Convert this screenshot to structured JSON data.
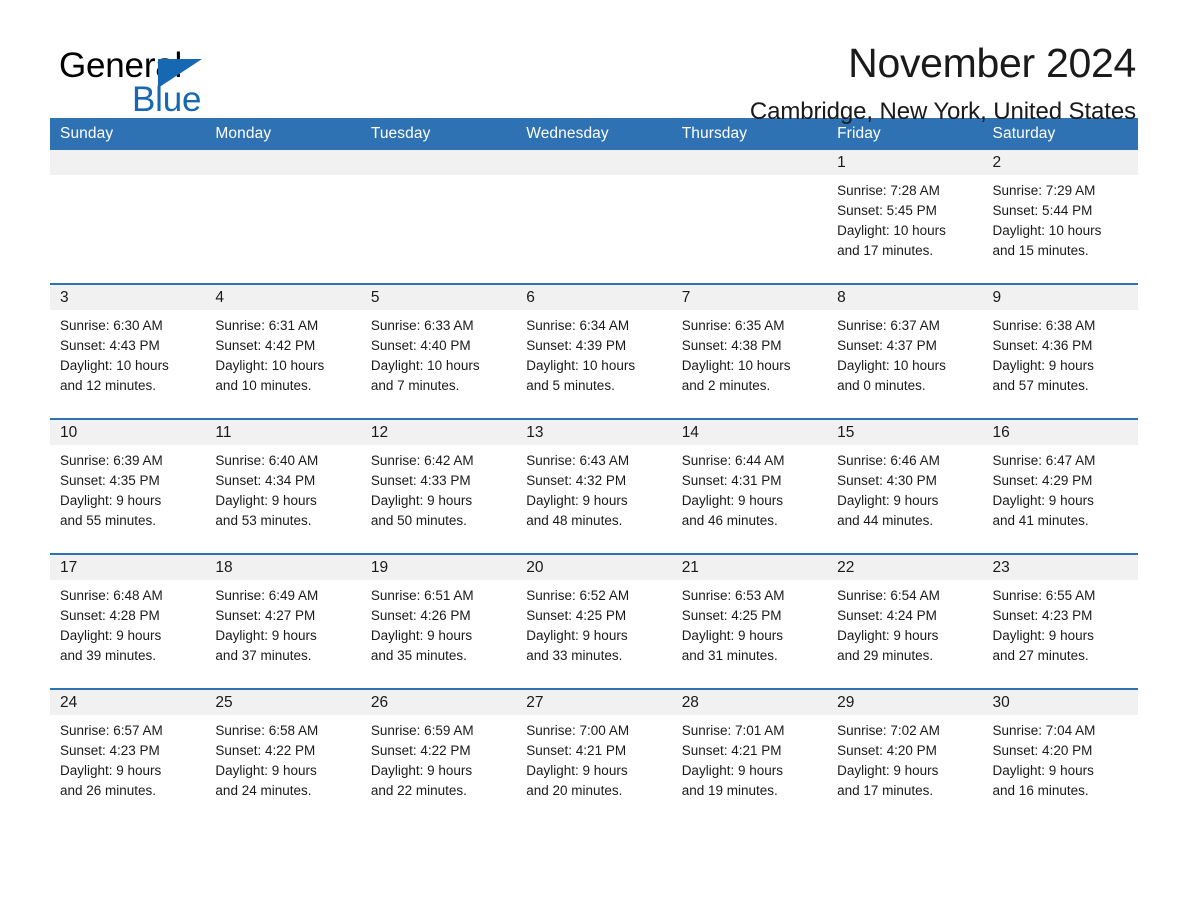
{
  "brand": {
    "name_part1": "General",
    "name_part2": "Blue",
    "accent_color": "#1668b3"
  },
  "header": {
    "month_title": "November 2024",
    "location": "Cambridge, New York, United States"
  },
  "theme": {
    "header_row_bg": "#2f72b3",
    "daynum_band_bg": "#f1f1f1",
    "text_color": "#1a1a1a"
  },
  "calendar": {
    "weekday_headers": [
      "Sunday",
      "Monday",
      "Tuesday",
      "Wednesday",
      "Thursday",
      "Friday",
      "Saturday"
    ],
    "labels": {
      "sunrise_prefix": "Sunrise:",
      "sunset_prefix": "Sunset:",
      "daylight_prefix": "Daylight:"
    },
    "weeks": [
      [
        {
          "day": "",
          "empty": true
        },
        {
          "day": "",
          "empty": true
        },
        {
          "day": "",
          "empty": true
        },
        {
          "day": "",
          "empty": true
        },
        {
          "day": "",
          "empty": true
        },
        {
          "day": "1",
          "sunrise": "Sunrise: 7:28 AM",
          "sunset": "Sunset: 5:45 PM",
          "daylight_line1": "Daylight: 10 hours",
          "daylight_line2": "and 17 minutes."
        },
        {
          "day": "2",
          "sunrise": "Sunrise: 7:29 AM",
          "sunset": "Sunset: 5:44 PM",
          "daylight_line1": "Daylight: 10 hours",
          "daylight_line2": "and 15 minutes."
        }
      ],
      [
        {
          "day": "3",
          "sunrise": "Sunrise: 6:30 AM",
          "sunset": "Sunset: 4:43 PM",
          "daylight_line1": "Daylight: 10 hours",
          "daylight_line2": "and 12 minutes."
        },
        {
          "day": "4",
          "sunrise": "Sunrise: 6:31 AM",
          "sunset": "Sunset: 4:42 PM",
          "daylight_line1": "Daylight: 10 hours",
          "daylight_line2": "and 10 minutes."
        },
        {
          "day": "5",
          "sunrise": "Sunrise: 6:33 AM",
          "sunset": "Sunset: 4:40 PM",
          "daylight_line1": "Daylight: 10 hours",
          "daylight_line2": "and 7 minutes."
        },
        {
          "day": "6",
          "sunrise": "Sunrise: 6:34 AM",
          "sunset": "Sunset: 4:39 PM",
          "daylight_line1": "Daylight: 10 hours",
          "daylight_line2": "and 5 minutes."
        },
        {
          "day": "7",
          "sunrise": "Sunrise: 6:35 AM",
          "sunset": "Sunset: 4:38 PM",
          "daylight_line1": "Daylight: 10 hours",
          "daylight_line2": "and 2 minutes."
        },
        {
          "day": "8",
          "sunrise": "Sunrise: 6:37 AM",
          "sunset": "Sunset: 4:37 PM",
          "daylight_line1": "Daylight: 10 hours",
          "daylight_line2": "and 0 minutes."
        },
        {
          "day": "9",
          "sunrise": "Sunrise: 6:38 AM",
          "sunset": "Sunset: 4:36 PM",
          "daylight_line1": "Daylight: 9 hours",
          "daylight_line2": "and 57 minutes."
        }
      ],
      [
        {
          "day": "10",
          "sunrise": "Sunrise: 6:39 AM",
          "sunset": "Sunset: 4:35 PM",
          "daylight_line1": "Daylight: 9 hours",
          "daylight_line2": "and 55 minutes."
        },
        {
          "day": "11",
          "sunrise": "Sunrise: 6:40 AM",
          "sunset": "Sunset: 4:34 PM",
          "daylight_line1": "Daylight: 9 hours",
          "daylight_line2": "and 53 minutes."
        },
        {
          "day": "12",
          "sunrise": "Sunrise: 6:42 AM",
          "sunset": "Sunset: 4:33 PM",
          "daylight_line1": "Daylight: 9 hours",
          "daylight_line2": "and 50 minutes."
        },
        {
          "day": "13",
          "sunrise": "Sunrise: 6:43 AM",
          "sunset": "Sunset: 4:32 PM",
          "daylight_line1": "Daylight: 9 hours",
          "daylight_line2": "and 48 minutes."
        },
        {
          "day": "14",
          "sunrise": "Sunrise: 6:44 AM",
          "sunset": "Sunset: 4:31 PM",
          "daylight_line1": "Daylight: 9 hours",
          "daylight_line2": "and 46 minutes."
        },
        {
          "day": "15",
          "sunrise": "Sunrise: 6:46 AM",
          "sunset": "Sunset: 4:30 PM",
          "daylight_line1": "Daylight: 9 hours",
          "daylight_line2": "and 44 minutes."
        },
        {
          "day": "16",
          "sunrise": "Sunrise: 6:47 AM",
          "sunset": "Sunset: 4:29 PM",
          "daylight_line1": "Daylight: 9 hours",
          "daylight_line2": "and 41 minutes."
        }
      ],
      [
        {
          "day": "17",
          "sunrise": "Sunrise: 6:48 AM",
          "sunset": "Sunset: 4:28 PM",
          "daylight_line1": "Daylight: 9 hours",
          "daylight_line2": "and 39 minutes."
        },
        {
          "day": "18",
          "sunrise": "Sunrise: 6:49 AM",
          "sunset": "Sunset: 4:27 PM",
          "daylight_line1": "Daylight: 9 hours",
          "daylight_line2": "and 37 minutes."
        },
        {
          "day": "19",
          "sunrise": "Sunrise: 6:51 AM",
          "sunset": "Sunset: 4:26 PM",
          "daylight_line1": "Daylight: 9 hours",
          "daylight_line2": "and 35 minutes."
        },
        {
          "day": "20",
          "sunrise": "Sunrise: 6:52 AM",
          "sunset": "Sunset: 4:25 PM",
          "daylight_line1": "Daylight: 9 hours",
          "daylight_line2": "and 33 minutes."
        },
        {
          "day": "21",
          "sunrise": "Sunrise: 6:53 AM",
          "sunset": "Sunset: 4:25 PM",
          "daylight_line1": "Daylight: 9 hours",
          "daylight_line2": "and 31 minutes."
        },
        {
          "day": "22",
          "sunrise": "Sunrise: 6:54 AM",
          "sunset": "Sunset: 4:24 PM",
          "daylight_line1": "Daylight: 9 hours",
          "daylight_line2": "and 29 minutes."
        },
        {
          "day": "23",
          "sunrise": "Sunrise: 6:55 AM",
          "sunset": "Sunset: 4:23 PM",
          "daylight_line1": "Daylight: 9 hours",
          "daylight_line2": "and 27 minutes."
        }
      ],
      [
        {
          "day": "24",
          "sunrise": "Sunrise: 6:57 AM",
          "sunset": "Sunset: 4:23 PM",
          "daylight_line1": "Daylight: 9 hours",
          "daylight_line2": "and 26 minutes."
        },
        {
          "day": "25",
          "sunrise": "Sunrise: 6:58 AM",
          "sunset": "Sunset: 4:22 PM",
          "daylight_line1": "Daylight: 9 hours",
          "daylight_line2": "and 24 minutes."
        },
        {
          "day": "26",
          "sunrise": "Sunrise: 6:59 AM",
          "sunset": "Sunset: 4:22 PM",
          "daylight_line1": "Daylight: 9 hours",
          "daylight_line2": "and 22 minutes."
        },
        {
          "day": "27",
          "sunrise": "Sunrise: 7:00 AM",
          "sunset": "Sunset: 4:21 PM",
          "daylight_line1": "Daylight: 9 hours",
          "daylight_line2": "and 20 minutes."
        },
        {
          "day": "28",
          "sunrise": "Sunrise: 7:01 AM",
          "sunset": "Sunset: 4:21 PM",
          "daylight_line1": "Daylight: 9 hours",
          "daylight_line2": "and 19 minutes."
        },
        {
          "day": "29",
          "sunrise": "Sunrise: 7:02 AM",
          "sunset": "Sunset: 4:20 PM",
          "daylight_line1": "Daylight: 9 hours",
          "daylight_line2": "and 17 minutes."
        },
        {
          "day": "30",
          "sunrise": "Sunrise: 7:04 AM",
          "sunset": "Sunset: 4:20 PM",
          "daylight_line1": "Daylight: 9 hours",
          "daylight_line2": "and 16 minutes."
        }
      ]
    ]
  }
}
